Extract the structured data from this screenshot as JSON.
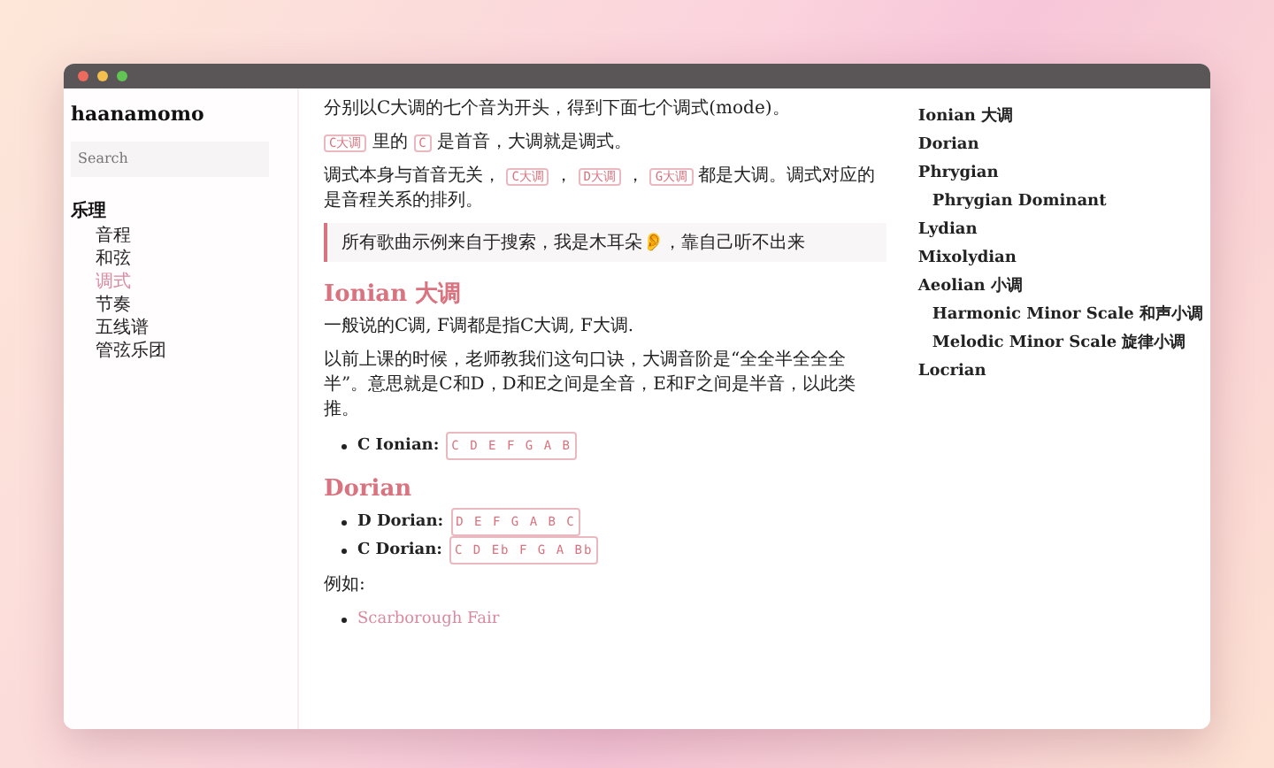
{
  "sidebar": {
    "title": "haanamomo",
    "search": {
      "placeholder": "Search"
    },
    "sections": [
      {
        "label": "乐理",
        "children": [
          {
            "label": "音程",
            "selected": false
          },
          {
            "label": "和弦",
            "selected": false
          },
          {
            "label": "调式",
            "selected": true
          },
          {
            "label": "节奏",
            "selected": false
          },
          {
            "label": "五线谱",
            "selected": false
          },
          {
            "label": "管弦乐团",
            "selected": false
          }
        ]
      }
    ]
  },
  "content": {
    "blocks": [
      {
        "kind": "paragraph",
        "segments": [
          {
            "kind": "text",
            "text": "分别以C大调的七个音为开头，得到下面七个调式(mode)。"
          }
        ]
      },
      {
        "kind": "paragraph",
        "segments": [
          {
            "kind": "code",
            "text": "C大调"
          },
          {
            "kind": "text",
            "text": " 里的 "
          },
          {
            "kind": "code",
            "text": "C"
          },
          {
            "kind": "text",
            "text": " 是首音，大调就是调式。"
          }
        ]
      },
      {
        "kind": "paragraph",
        "segments": [
          {
            "kind": "text",
            "text": "调式本身与首音无关， "
          },
          {
            "kind": "code",
            "text": "C大调"
          },
          {
            "kind": "text",
            "text": " ， "
          },
          {
            "kind": "code",
            "text": "D大调"
          },
          {
            "kind": "text",
            "text": " ， "
          },
          {
            "kind": "code",
            "text": "G大调"
          },
          {
            "kind": "text",
            "text": " 都是大调。调式对应的是音程关系的排列。"
          }
        ]
      },
      {
        "kind": "quote",
        "text": "所有歌曲示例来自于搜索，我是木耳朵👂，靠自己听不出来"
      },
      {
        "kind": "heading",
        "text": "Ionian 大调"
      },
      {
        "kind": "paragraph",
        "segments": [
          {
            "kind": "text",
            "text": "一般说的C调, F调都是指C大调, F大调."
          }
        ]
      },
      {
        "kind": "paragraph",
        "segments": [
          {
            "kind": "text",
            "text": "以前上课的时候，老师教我们这句口诀，大调音阶是“全全半全全全半”。意思就是C和D，D和E之间是全音，E和F之间是半音，以此类推。"
          }
        ]
      },
      {
        "kind": "list",
        "items": [
          {
            "label": "C Ionian:",
            "code": "C D E F G A B"
          }
        ]
      },
      {
        "kind": "heading",
        "text": "Dorian"
      },
      {
        "kind": "list",
        "items": [
          {
            "label": "D Dorian:",
            "code": "D E F G A B C"
          },
          {
            "label": "C Dorian:",
            "code": "C D Eb F G A Bb"
          }
        ]
      },
      {
        "kind": "paragraph",
        "segments": [
          {
            "kind": "text",
            "text": "例如:"
          }
        ]
      },
      {
        "kind": "links",
        "items": [
          {
            "text": "Scarborough Fair"
          }
        ]
      }
    ]
  },
  "toc": [
    {
      "label": "Ionian 大调"
    },
    {
      "label": "Dorian"
    },
    {
      "label": "Phrygian",
      "children": [
        {
          "label": "Phrygian Dominant"
        }
      ]
    },
    {
      "label": "Lydian"
    },
    {
      "label": "Mixolydian"
    },
    {
      "label": "Aeolian 小调",
      "children": [
        {
          "label": "Harmonic Minor Scale 和声小调"
        },
        {
          "label": "Melodic Minor Scale 旋律小调"
        }
      ]
    },
    {
      "label": "Locrian"
    }
  ]
}
